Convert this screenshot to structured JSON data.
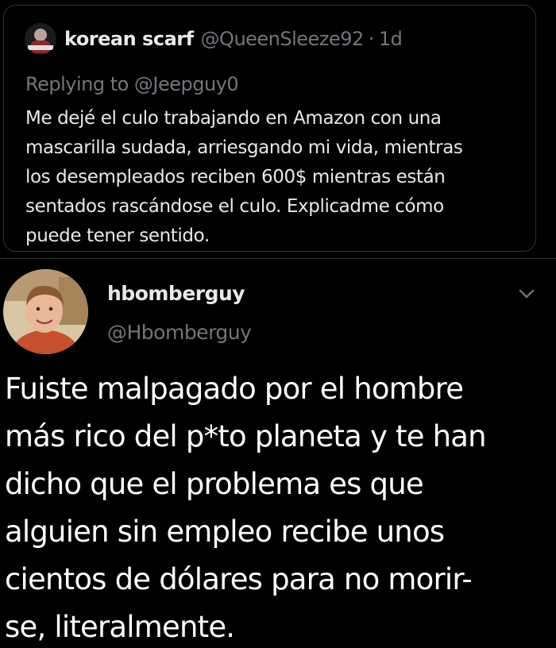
{
  "quoted_tweet": {
    "display_name": "korean scarf",
    "handle": "@QueenSleeze92",
    "separator": "·",
    "time": "1d",
    "replying_to": "Replying to @Jeepguy0",
    "body_lines": [
      "Me dejé el culo trabajando en Amazon con una",
      "mascarilla sudada, arriesgando mi vida, mientras",
      "los desempleados reciben 600$ mientras están",
      "sentados rascándose el culo. Explicadme cómo",
      "puede tener sentido."
    ]
  },
  "tweet": {
    "display_name": "hbomberguy",
    "handle": "@Hbomberguy",
    "menu_icon": "chevron-down-icon",
    "body_lines": [
      "Fuiste malpagado por el hombre",
      "más rico del p*to planeta y te han",
      "dicho que el problema es que",
      "alguien sin empleo recibe unos",
      "cientos de dólares para no morir-",
      "se, literalmente."
    ]
  },
  "colors": {
    "background": "#000000",
    "primary_text": "#e7e9ea",
    "secondary_text": "#71767b",
    "border": "#2f3336"
  }
}
